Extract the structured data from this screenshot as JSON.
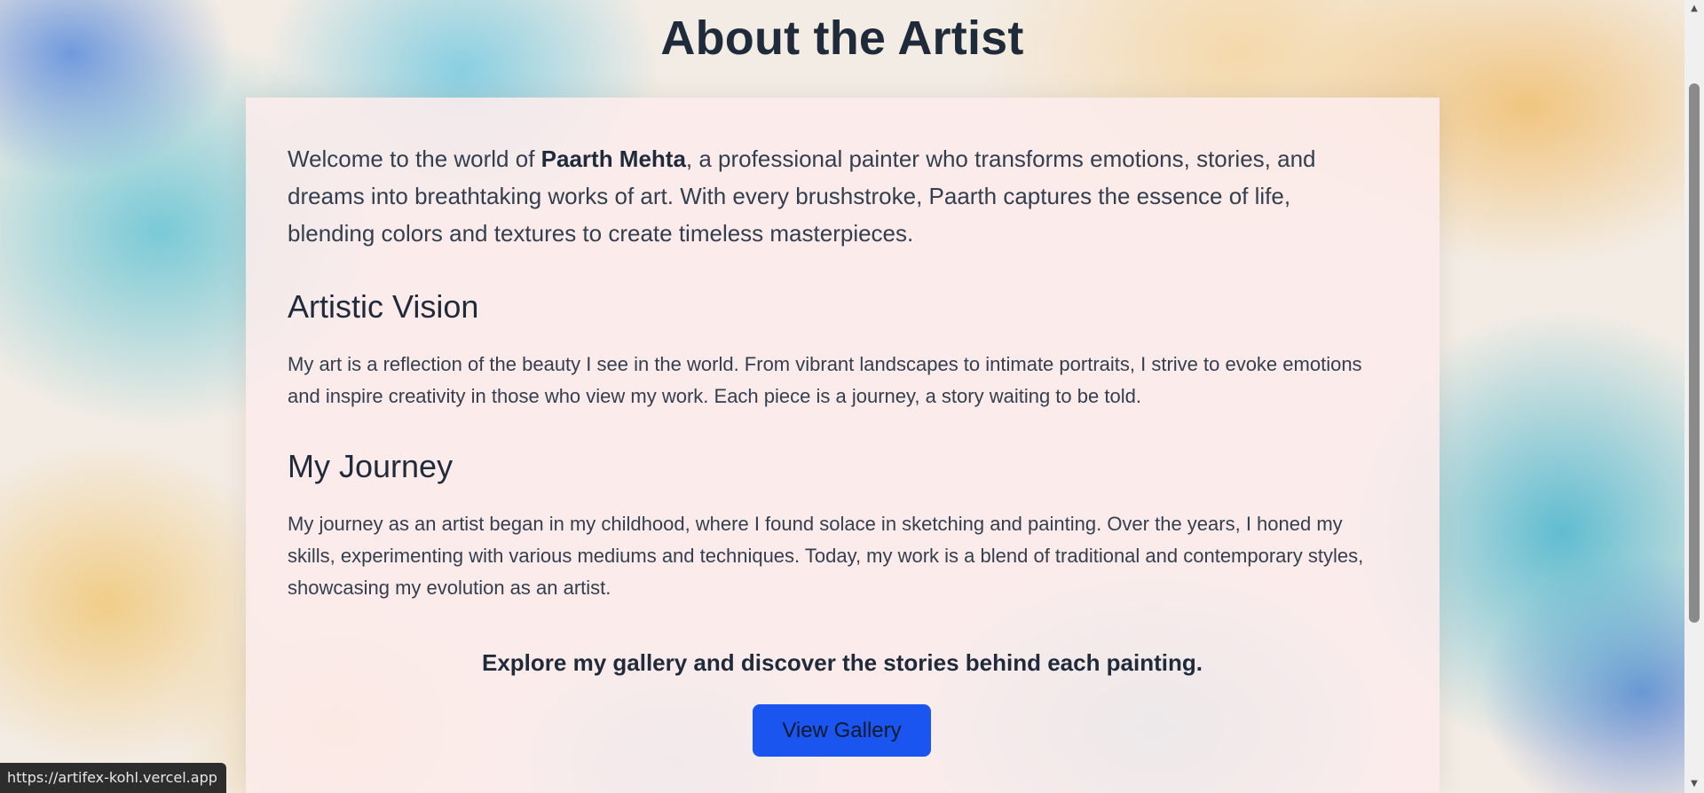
{
  "header": {
    "title": "About the Artist"
  },
  "intro": {
    "prefix": "Welcome to the world of ",
    "artist_name": "Paarth Mehta",
    "suffix": ", a professional painter who transforms emotions, stories, and dreams into breathtaking works of art. With every brushstroke, Paarth captures the essence of life, blending colors and textures to create timeless masterpieces."
  },
  "sections": [
    {
      "heading": "Artistic Vision",
      "text": "My art is a reflection of the beauty I see in the world. From vibrant landscapes to intimate portraits, I strive to evoke emotions and inspire creativity in those who view my work. Each piece is a journey, a story waiting to be told."
    },
    {
      "heading": "My Journey",
      "text": "My journey as an artist began in my childhood, where I found solace in sketching and painting. Over the years, I honed my skills, experimenting with various mediums and techniques. Today, my work is a blend of traditional and contemporary styles, showcasing my evolution as an artist."
    }
  ],
  "cta": {
    "text": "Explore my gallery and discover the stories behind each painting.",
    "button_label": "View Gallery"
  },
  "status_bar": {
    "url": "https://artifex-kohl.vercel.app"
  },
  "scrollbar": {
    "up_icon": "scroll-up-arrow",
    "down_icon": "scroll-down-arrow"
  },
  "colors": {
    "button_bg": "#1a55f0",
    "heading": "#1f2a3a",
    "body_text": "#333e4e",
    "card_bg": "#fcecec"
  }
}
